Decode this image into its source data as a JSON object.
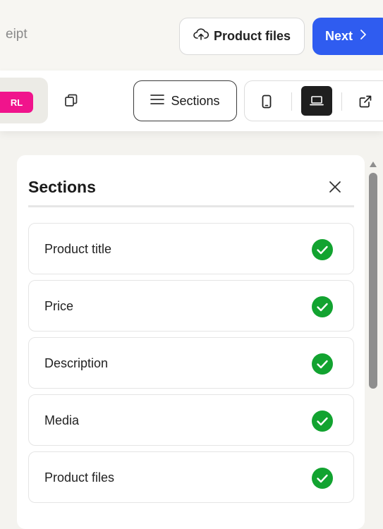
{
  "header": {
    "crumb_text": "eipt",
    "product_files_button": "Product files",
    "next_button": "Next",
    "next_chevron": "›"
  },
  "toolbar": {
    "url_badge": "RL",
    "sections_button": "Sections",
    "accent_pink": "#f0148c",
    "accent_blue": "#2f5cf0",
    "device_selected": "desktop"
  },
  "panel": {
    "title": "Sections",
    "items": [
      {
        "label": "Product title",
        "status": "complete"
      },
      {
        "label": "Price",
        "status": "complete"
      },
      {
        "label": "Description",
        "status": "complete"
      },
      {
        "label": "Media",
        "status": "complete"
      },
      {
        "label": "Product files",
        "status": "complete"
      }
    ],
    "check_color": "#12a330"
  }
}
